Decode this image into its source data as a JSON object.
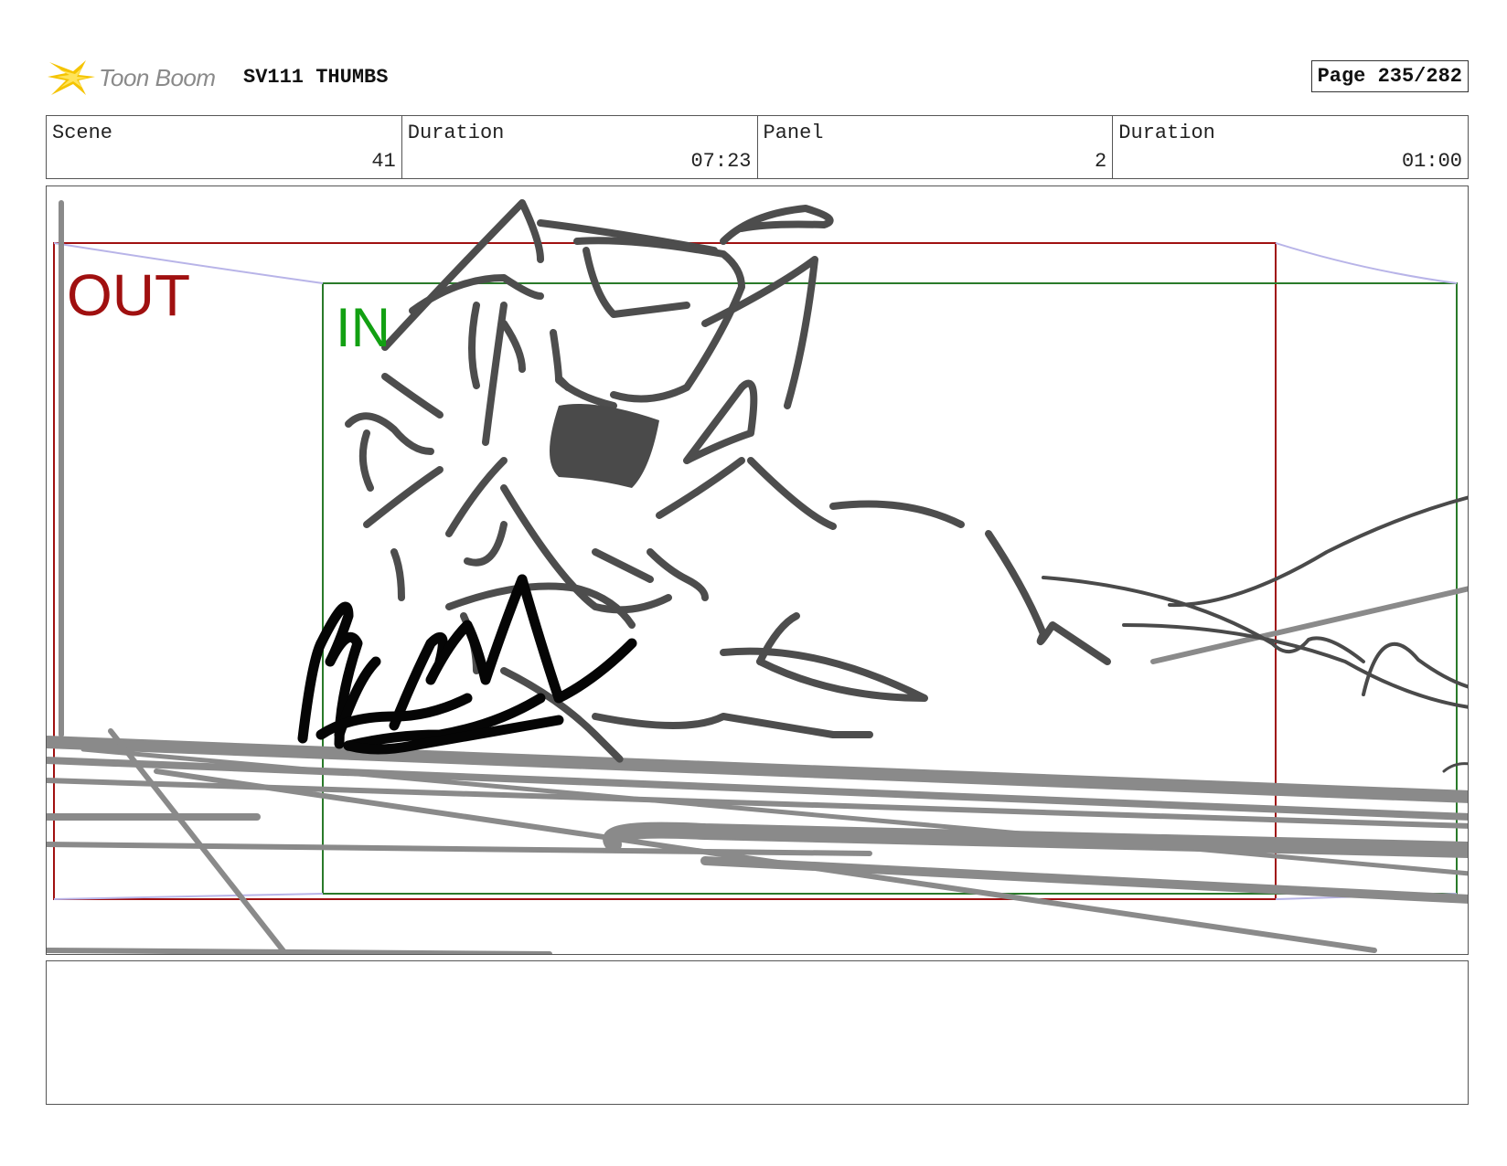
{
  "header": {
    "logo_text": "Toon Boom",
    "project_title": "SV111 THUMBS",
    "page_label": "Page 235/282"
  },
  "info": {
    "scene_label": "Scene",
    "scene_value": "41",
    "scene_duration_label": "Duration",
    "scene_duration_value": "07:23",
    "panel_label": "Panel",
    "panel_value": "2",
    "panel_duration_label": "Duration",
    "panel_duration_value": "01:00"
  },
  "panel": {
    "out_label": "OUT",
    "in_label": "IN",
    "out_frame_color": "#a01010",
    "in_frame_color": "#12a012"
  },
  "notes": {
    "text": ""
  }
}
